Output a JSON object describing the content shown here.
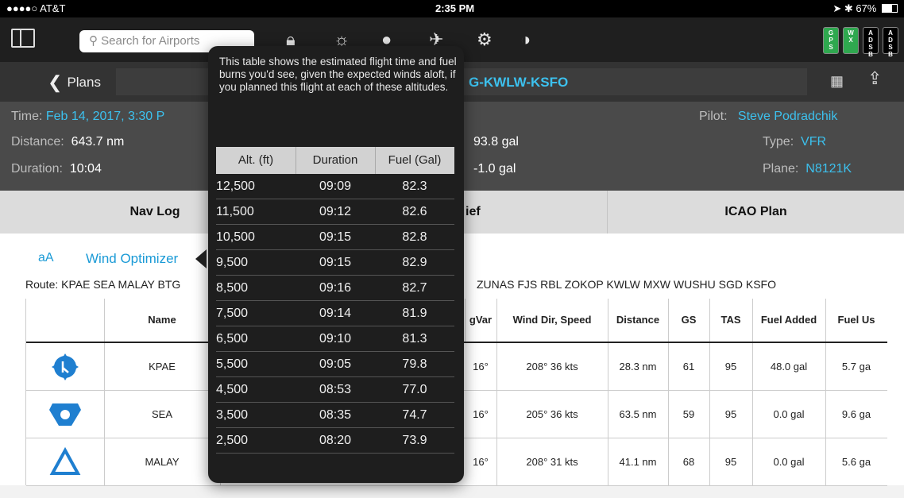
{
  "status_bar": {
    "carrier": "●●●●○ AT&T",
    "time": "2:35 PM",
    "battery": "67%"
  },
  "toolbar": {
    "search_placeholder": "Search for Airports",
    "badges": [
      {
        "label": "GPS",
        "color": "#2fa84f"
      },
      {
        "label": "WX",
        "color": "#2fa84f"
      },
      {
        "label": "ADSB",
        "color": "#000000"
      },
      {
        "label": "ADSB",
        "color": "#000000"
      }
    ]
  },
  "header": {
    "back_label": "Plans",
    "plan_title": "G-KWLW-KSFO"
  },
  "info": {
    "time_label": "Time:",
    "time_value": "Feb 14, 2017, 3:30 P",
    "distance_label": "Distance:",
    "distance_value": "643.7 nm",
    "duration_label": "Duration:",
    "duration_value": "10:04",
    "fuel1": "93.8 gal",
    "fuel2": "-1.0 gal",
    "pilot_label": "Pilot:",
    "pilot_value": "Steve Podradchik",
    "type_label": "Type:",
    "type_value": "VFR",
    "plane_label": "Plane:",
    "plane_value": "N8121K"
  },
  "tabs": [
    "Nav Log",
    "ief",
    "ICAO Plan"
  ],
  "content": {
    "aa_label": "aA",
    "wind_optimizer_label": "Wind Optimizer",
    "route_left": "Route: KPAE SEA MALAY BTG",
    "route_right": "ZUNAS FJS RBL ZOKOP KWLW MXW WUSHU SGD KSFO"
  },
  "nav_table": {
    "headers": [
      "",
      "Name",
      "",
      "gVar",
      "Wind Dir, Speed",
      "Distance",
      "GS",
      "TAS",
      "Fuel Added",
      "Fuel Us"
    ],
    "rows": [
      {
        "name": "KPAE",
        "gvar": "16°",
        "wind": "208° 36 kts",
        "distance": "28.3 nm",
        "gs": "61",
        "tas": "95",
        "fuel_added": "48.0 gal",
        "fuel_used": "5.7 ga"
      },
      {
        "name": "SEA",
        "gvar": "16°",
        "wind": "205° 36 kts",
        "distance": "63.5 nm",
        "gs": "59",
        "tas": "95",
        "fuel_added": "0.0 gal",
        "fuel_used": "9.6 ga"
      },
      {
        "name": "MALAY",
        "gvar": "16°",
        "wind": "208° 31 kts",
        "distance": "41.1 nm",
        "gs": "68",
        "tas": "95",
        "fuel_added": "0.0 gal",
        "fuel_used": "5.6 ga"
      }
    ]
  },
  "popover": {
    "description": "This table shows the estimated flight time and fuel burns you'd see, given the expected winds aloft, if you planned this flight at each of these altitudes.",
    "headers": [
      "Alt. (ft)",
      "Duration",
      "Fuel (Gal)"
    ],
    "rows": [
      [
        "12,500",
        "09:09",
        "82.3"
      ],
      [
        "11,500",
        "09:12",
        "82.6"
      ],
      [
        "10,500",
        "09:15",
        "82.8"
      ],
      [
        "9,500",
        "09:15",
        "82.9"
      ],
      [
        "8,500",
        "09:16",
        "82.7"
      ],
      [
        "7,500",
        "09:14",
        "81.9"
      ],
      [
        "6,500",
        "09:10",
        "81.3"
      ],
      [
        "5,500",
        "09:05",
        "79.8"
      ],
      [
        "4,500",
        "08:53",
        "77.0"
      ],
      [
        "3,500",
        "08:35",
        "74.7"
      ],
      [
        "2,500",
        "08:20",
        "73.9"
      ]
    ]
  },
  "colors": {
    "accent": "#3cc1ee",
    "link": "#1a9ad6",
    "waypoint": "#1f7fd0"
  }
}
